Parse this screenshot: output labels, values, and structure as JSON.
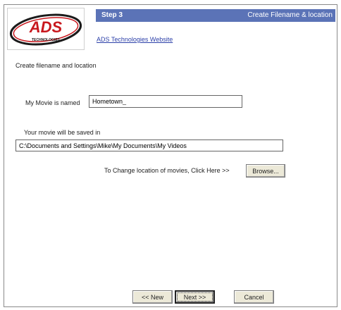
{
  "header": {
    "step": "Step 3",
    "title": "Create Filename & location"
  },
  "logo": {
    "brand": "ADS",
    "tagline": "TECHNOLOGIES",
    "brand_color": "#c8181e",
    "ring_color": "#1a1a1a"
  },
  "links": {
    "website": "ADS Technologies Website"
  },
  "form": {
    "instruction": "Create filename and location",
    "movie_label": "My Movie is named",
    "movie_value": "Hometown_",
    "saved_label": "Your movie will be saved in",
    "path_value": "C:\\Documents and Settings\\Mike\\My Documents\\My Videos",
    "change_text": "To Change location of movies, Click Here >>",
    "browse_label": "Browse..."
  },
  "footer": {
    "new_label": "<< New",
    "next_label": "Next >>",
    "cancel_label": "Cancel"
  },
  "colors": {
    "header_bg": "#5b73b7",
    "link": "#2b3fa8"
  }
}
